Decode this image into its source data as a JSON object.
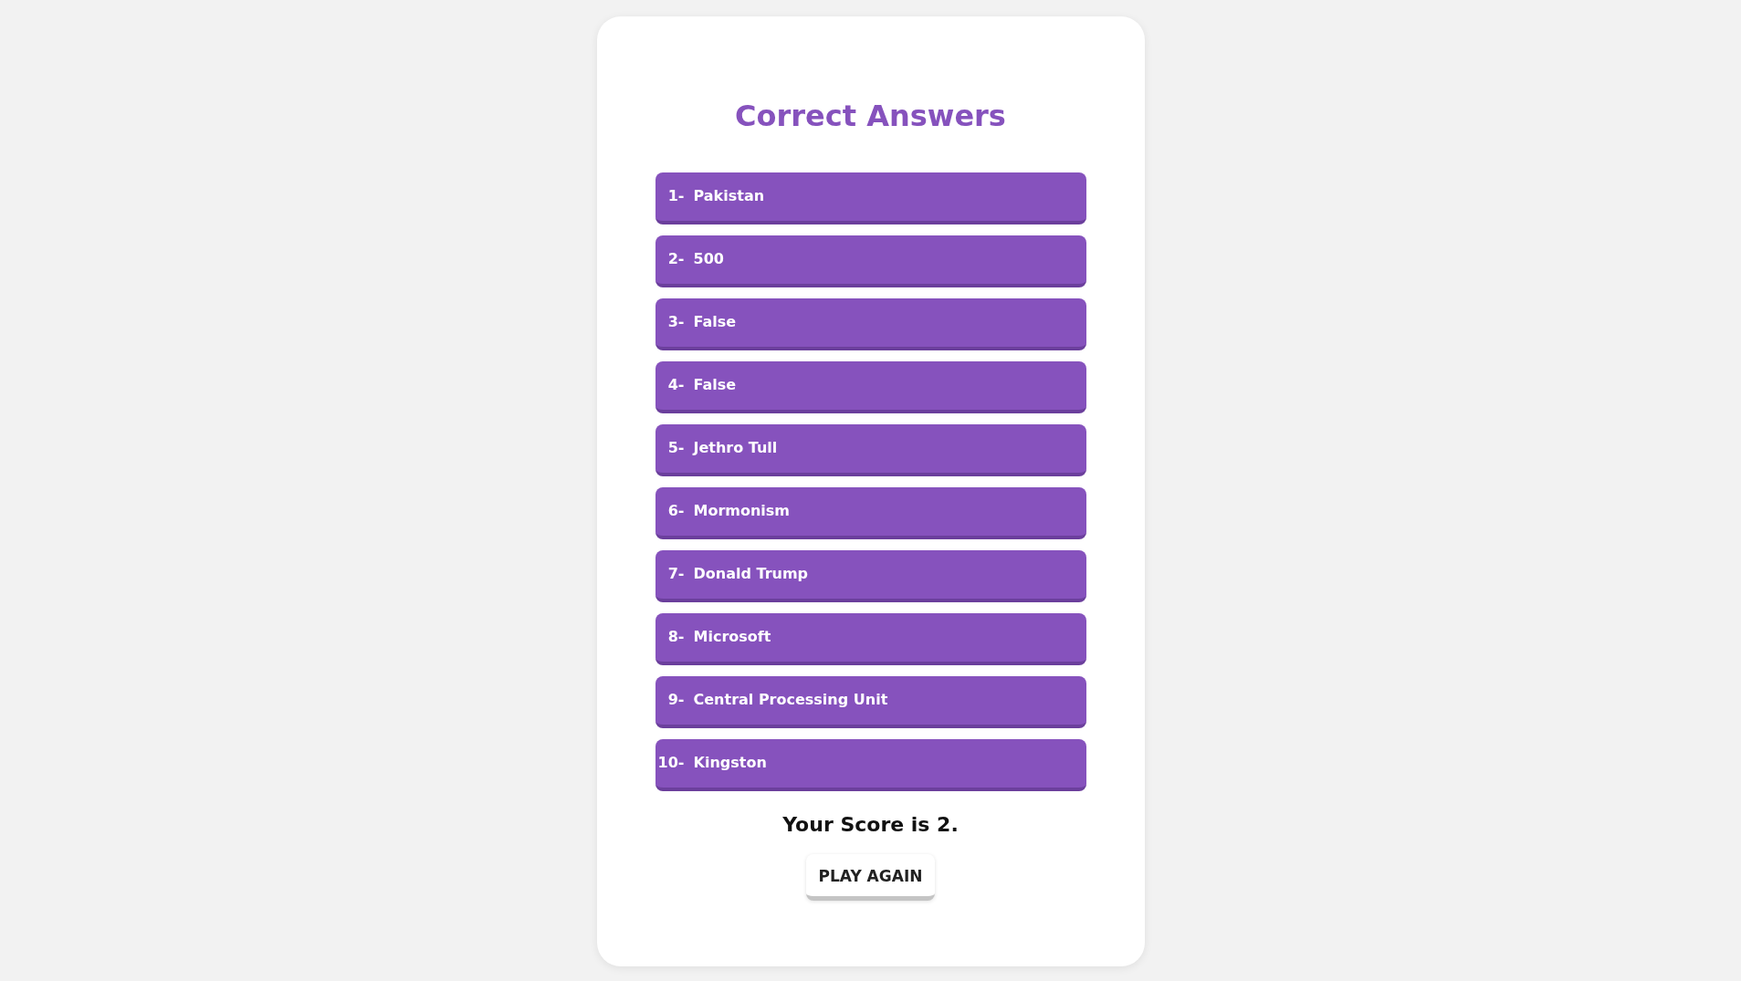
{
  "title": "Correct Answers",
  "answers": [
    {
      "number": "1-",
      "text": "Pakistan"
    },
    {
      "number": "2-",
      "text": "500"
    },
    {
      "number": "3-",
      "text": "False"
    },
    {
      "number": "4-",
      "text": "False"
    },
    {
      "number": "5-",
      "text": "Jethro Tull"
    },
    {
      "number": "6-",
      "text": "Mormonism"
    },
    {
      "number": "7-",
      "text": "Donald Trump"
    },
    {
      "number": "8-",
      "text": "Microsoft"
    },
    {
      "number": "9-",
      "text": "Central Processing Unit"
    },
    {
      "number": "10-",
      "text": "Kingston"
    }
  ],
  "score": "Your Score is 2.",
  "button": "PLAY AGAIN"
}
